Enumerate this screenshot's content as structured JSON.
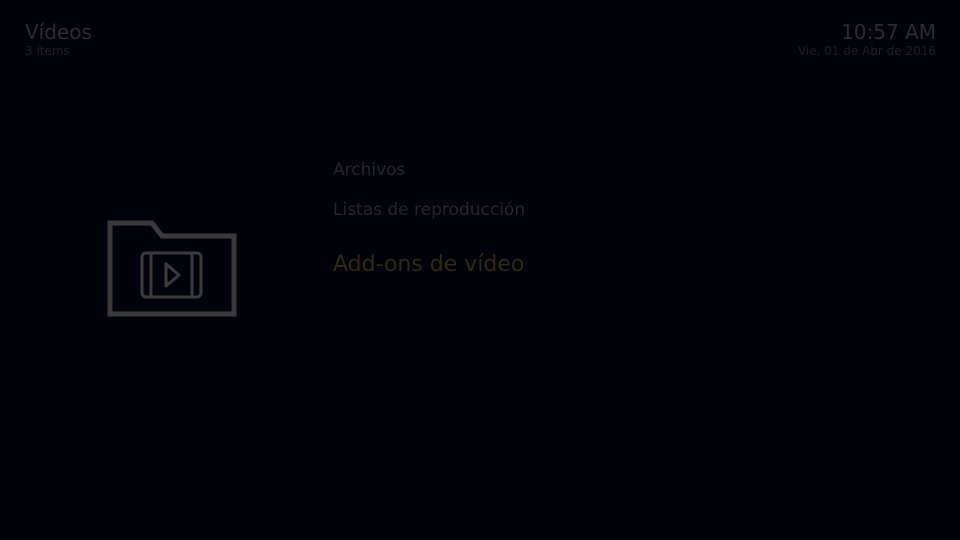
{
  "header": {
    "title": "Vídeos",
    "item_count": "3 ítems",
    "time": "10:57 AM",
    "date": "Vie, 01 de Abr de 2016"
  },
  "preview": {
    "icon": "video-folder-icon"
  },
  "menu": {
    "items": [
      {
        "label": "Archivos"
      },
      {
        "label": "Listas de reproducción"
      },
      {
        "label": "Add-ons de vídeo",
        "focused": true
      }
    ]
  },
  "colors": {
    "background": "#02020a",
    "text_dim": "#262628",
    "focused_text": "#2e2816",
    "icon": "#3a3a3c"
  }
}
